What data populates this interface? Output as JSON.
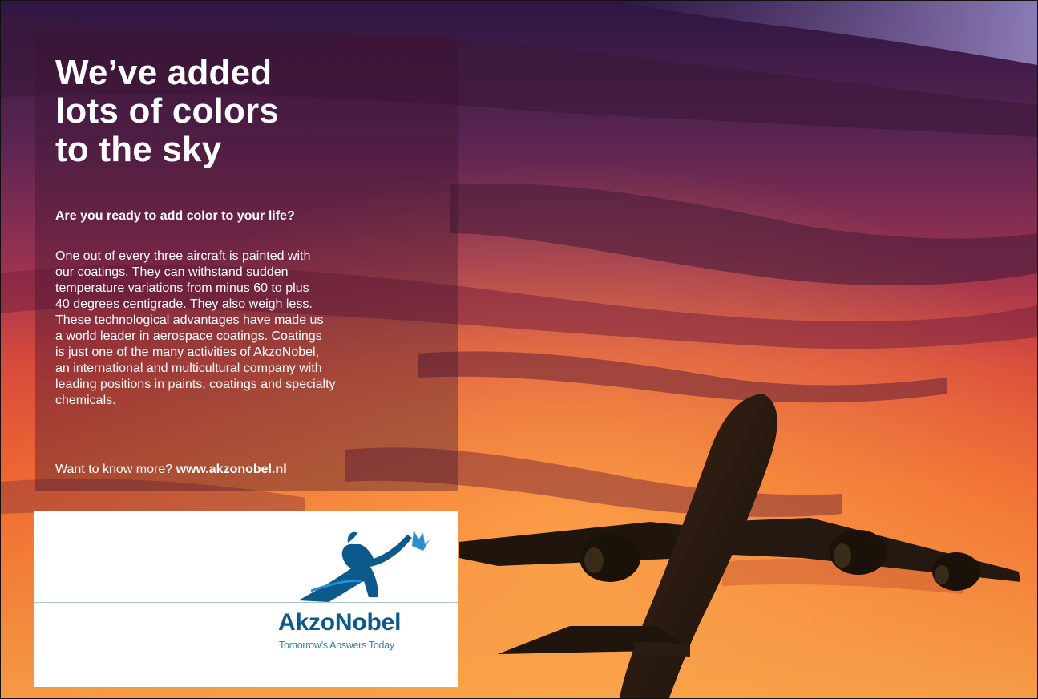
{
  "ad": {
    "headline": [
      "We’ve added",
      "lots of colors",
      "to the sky"
    ],
    "question": "Are you ready to add color to your life?",
    "body_lines": [
      "One out of every three aircraft is painted with",
      "our coatings. They can withstand sudden",
      "temperature variations from minus 60 to plus",
      "40 degrees centigrade. They also weigh less.",
      "These technological advantages have made us",
      "a world leader in aerospace coatings. Coatings",
      "is just one of the many activities of AkzoNobel,",
      "an international and multicultural company with",
      "leading positions in paints, coatings and specialty",
      "chemicals."
    ],
    "cta_prefix": "Want to know more? ",
    "cta_link": "www.akzonobel.nl"
  },
  "logo": {
    "brand": "AkzoNobel",
    "tagline": "Tomorrow’s Answers Today",
    "icon": "reaching-figure-logo"
  },
  "colors": {
    "brand_blue": "#0c5a8c",
    "panel_tint": "#3c1230",
    "sky_top": "#3a1a4a",
    "sky_bottom": "#f07a2a"
  }
}
